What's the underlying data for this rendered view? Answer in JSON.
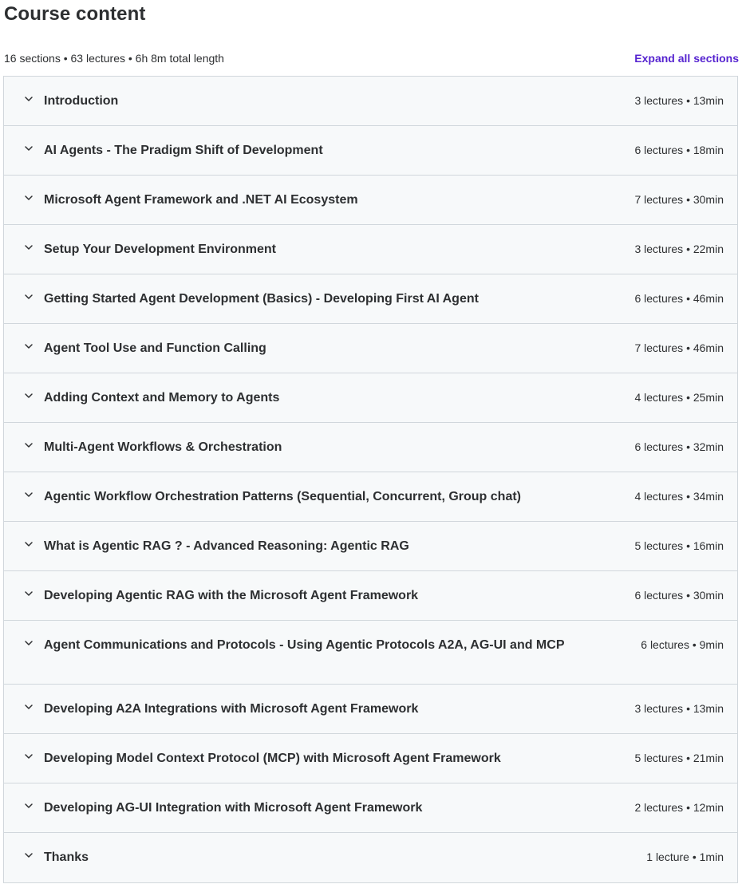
{
  "header": {
    "title": "Course content"
  },
  "summary": {
    "text": "16 sections • 63 lectures • 6h 8m total length",
    "expand_label": "Expand all sections"
  },
  "sections": [
    {
      "title": "Introduction",
      "meta": "3 lectures • 13min"
    },
    {
      "title": "AI Agents - The Pradigm Shift of Development",
      "meta": "6 lectures • 18min"
    },
    {
      "title": "Microsoft Agent Framework and .NET AI Ecosystem",
      "meta": "7 lectures • 30min"
    },
    {
      "title": "Setup Your Development Environment",
      "meta": "3 lectures • 22min"
    },
    {
      "title": "Getting Started Agent Development (Basics) - Developing First AI Agent",
      "meta": "6 lectures • 46min"
    },
    {
      "title": "Agent Tool Use and Function Calling",
      "meta": "7 lectures • 46min"
    },
    {
      "title": "Adding Context and Memory to Agents",
      "meta": "4 lectures • 25min"
    },
    {
      "title": "Multi-Agent Workflows & Orchestration",
      "meta": "6 lectures • 32min"
    },
    {
      "title": "Agentic Workflow Orchestration Patterns (Sequential, Concurrent, Group chat)",
      "meta": "4 lectures • 34min"
    },
    {
      "title": "What is Agentic RAG ? - Advanced Reasoning: Agentic RAG",
      "meta": "5 lectures • 16min"
    },
    {
      "title": "Developing Agentic RAG with the Microsoft Agent Framework",
      "meta": "6 lectures • 30min"
    },
    {
      "title": "Agent Communications and Protocols - Using Agentic Protocols A2A, AG-UI and MCP",
      "meta": "6 lectures • 9min"
    },
    {
      "title": "Developing A2A Integrations with Microsoft Agent Framework",
      "meta": "3 lectures • 13min"
    },
    {
      "title": "Developing Model Context Protocol (MCP) with Microsoft Agent Framework",
      "meta": "5 lectures • 21min"
    },
    {
      "title": "Developing AG-UI Integration with Microsoft Agent Framework",
      "meta": "2 lectures • 12min"
    },
    {
      "title": "Thanks",
      "meta": "1 lecture • 1min"
    }
  ],
  "icons": {
    "section_toggle": "chevron-down-icon"
  },
  "colors": {
    "accent": "#5624d0",
    "text": "#2d2f31",
    "section_bg": "#f7f9fa",
    "border": "#d1d7dc"
  }
}
